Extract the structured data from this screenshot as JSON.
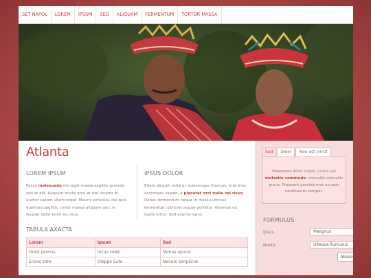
{
  "nav": {
    "items": [
      "Set napol",
      "Lorem",
      "Ipsum",
      "Sed",
      "Aliquam",
      "Fermentum",
      "Tortor massa"
    ]
  },
  "hero": {
    "icon": "photo-two-people-traditional-headdress"
  },
  "page_title": "Atlanta",
  "col1": {
    "heading": "Lorem ipsum",
    "text_before": "Fusce ",
    "bold": "malesuada",
    "text_after": " nisi eget massa sagittis gravida sed at elit. Aliquam mollis arcu et nisi viverra id auctor sapien ullamcorper. Mauris vehicula, dui quis euismod sagittis, tortor massa aliquam orci, in feugiat dolor enim eu risus."
  },
  "col2": {
    "heading": "Ipsus dolor",
    "text_before": "Etiam aliquet, ante ac scelerisque rhoncus, erat eros accumsan sapien, a ",
    "bold": "placerat orci nulla vel risus",
    "text_after": ". Donec fermentum neque in massa ultrices fermentum ultricies augue porttitor. Vivamus eu ligula tortor. Sed exacta lupus."
  },
  "table": {
    "title": "Tabula axacta",
    "headers": [
      "Lorem",
      "Ipsum",
      "Sed"
    ],
    "rows": [
      [
        "Dolor primus",
        "Incus volet",
        "Monus opulus"
      ],
      [
        "Encas sitre",
        "Oleppo Exto",
        "Novum simplicus"
      ]
    ]
  },
  "sidebar": {
    "tabs": [
      "Sed",
      "Dolor",
      "Non est vincit"
    ],
    "active_tab": "Sed",
    "tab_text_before": "Maecenas dolor turpis, luctus vel ",
    "tab_bold": "molestie commodo",
    "tab_text_after": ", convallis convallis purus. Praesent gravida erat eu sem vestibulum semper.",
    "form_title": "Formulus",
    "fields": [
      {
        "label": "Ipsus",
        "value": "Malignus"
      },
      {
        "label": "Noxto",
        "value": "Olleppa Rumusus"
      }
    ],
    "submit_label": "Absenden"
  },
  "colors": {
    "accent": "#c8403e",
    "background": "#b04848",
    "sidebar": "#f7dede"
  }
}
